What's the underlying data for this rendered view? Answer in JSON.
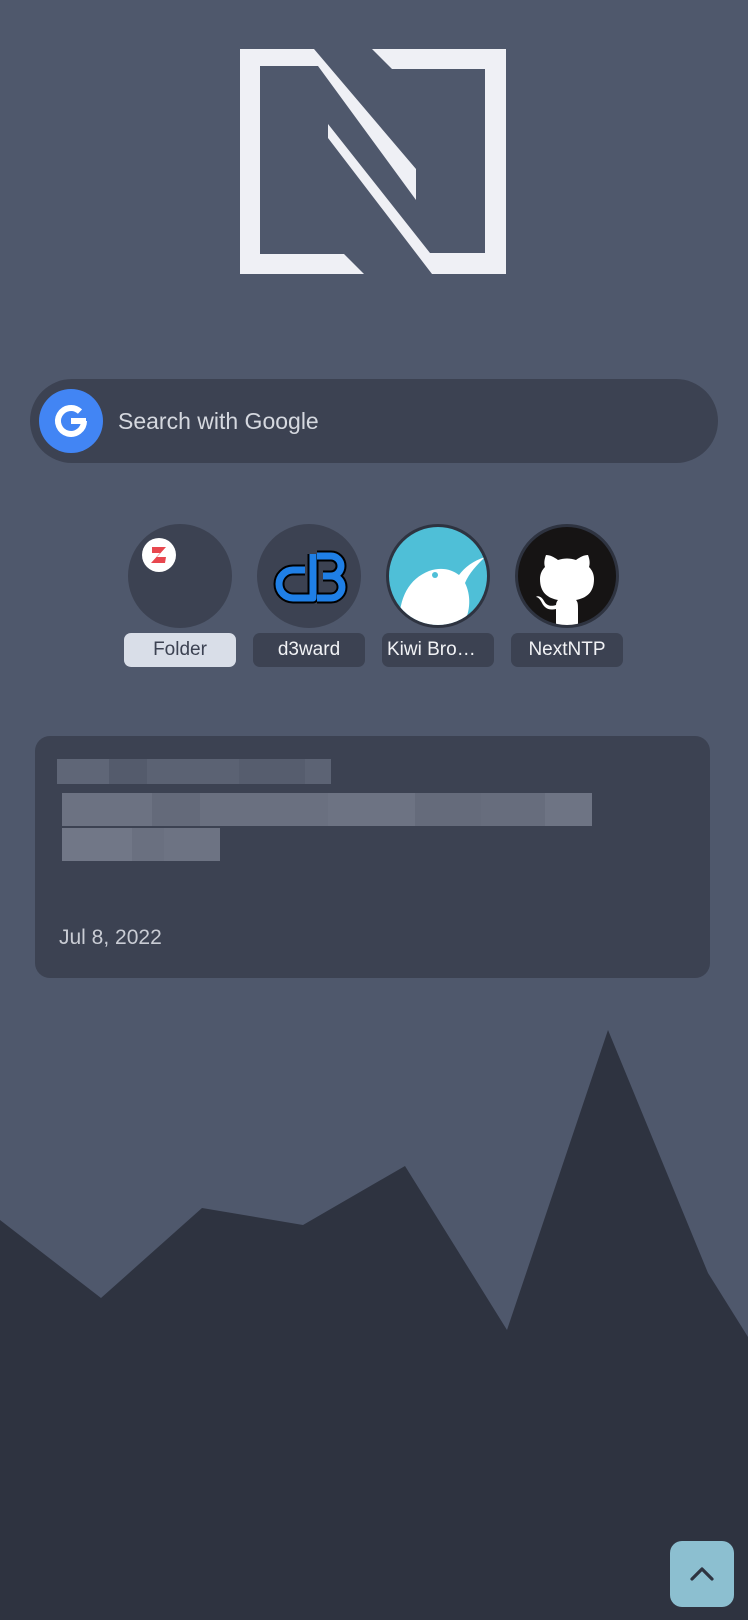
{
  "search": {
    "placeholder": "Search with Google",
    "engine_icon": "google-icon",
    "engine_color": "#4285f4"
  },
  "shortcuts": [
    {
      "label": "Folder",
      "icon": "zotero-icon"
    },
    {
      "label": "d3ward",
      "icon": "d3-icon"
    },
    {
      "label": "Kiwi Browser",
      "icon": "kiwi-bird-icon"
    },
    {
      "label": "NextNTP",
      "icon": "github-icon"
    }
  ],
  "card": {
    "date": "Jul 8, 2022"
  },
  "scroll_top": {
    "icon": "chevron-up-icon",
    "color": "#8cbfd0"
  },
  "colors": {
    "background": "#4f586c",
    "panel": "#3c4252",
    "mountains": "#2e3340",
    "logo": "#eff0f5"
  }
}
